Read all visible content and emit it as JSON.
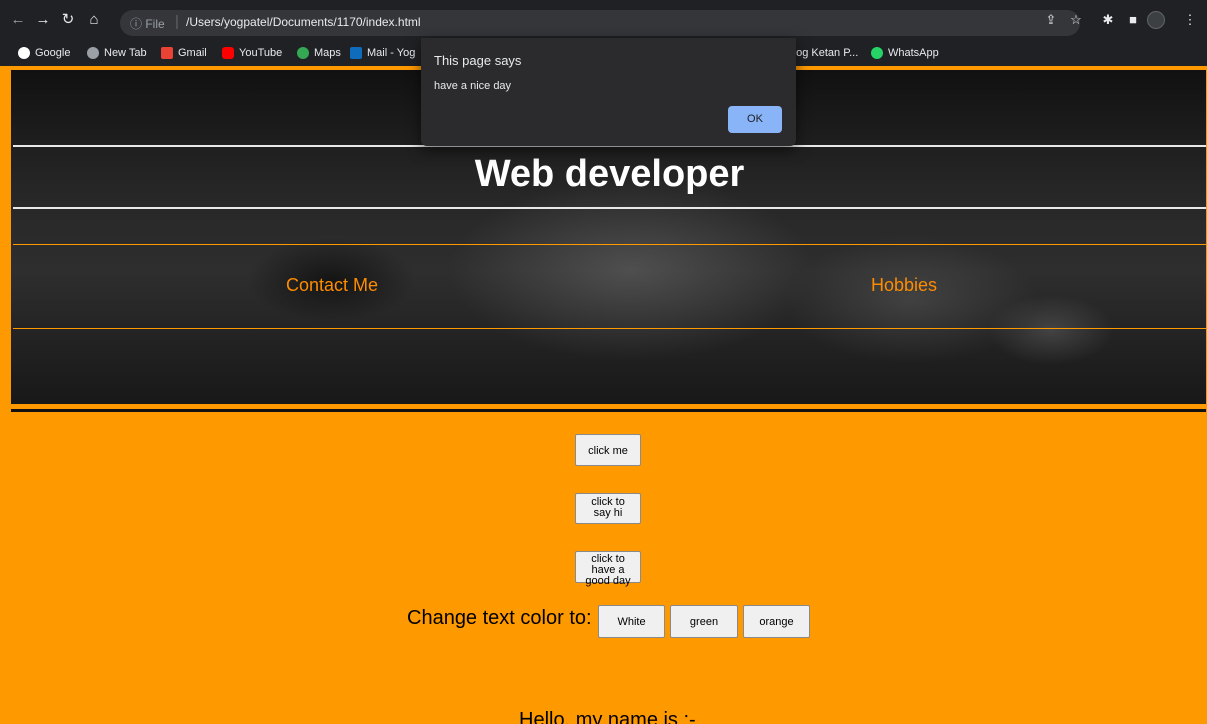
{
  "browser": {
    "url_prefix": "File",
    "url": "/Users/yogpatel/Documents/1170/index.html"
  },
  "bookmarks": [
    {
      "label": "Google",
      "icon": "google-icon",
      "color": "#ffffff"
    },
    {
      "label": "New Tab",
      "icon": "globe-icon",
      "color": "#9aa0a6"
    },
    {
      "label": "Gmail",
      "icon": "gmail-icon",
      "color": "#ea4335"
    },
    {
      "label": "YouTube",
      "icon": "youtube-icon",
      "color": "#ff0000"
    },
    {
      "label": "Maps",
      "icon": "maps-icon",
      "color": "#34a853"
    },
    {
      "label": "Mail - Yog",
      "icon": "outlook-icon",
      "color": "#0f6cbd"
    },
    {
      "label": "'og Ketan P...",
      "icon": "",
      "color": ""
    },
    {
      "label": "WhatsApp",
      "icon": "whatsapp-icon",
      "color": "#25d366"
    }
  ],
  "page": {
    "title": "Web developer",
    "nav": [
      "Contact Me",
      "Hobbies"
    ],
    "buttons": {
      "click_me": "click me",
      "say_hi": "click to say hi",
      "good_day": "click to have a good day"
    },
    "change_color_label": "Change text color to:",
    "color_buttons": [
      "White",
      "green",
      "orange"
    ],
    "hello_text": "Hello, my name is :-"
  },
  "dialog": {
    "title": "This page says",
    "message": "have a nice day",
    "ok": "OK"
  },
  "colors": {
    "page_bg": "#ff9900",
    "link": "#ff8c00",
    "ok_button": "#8ab4f8"
  }
}
